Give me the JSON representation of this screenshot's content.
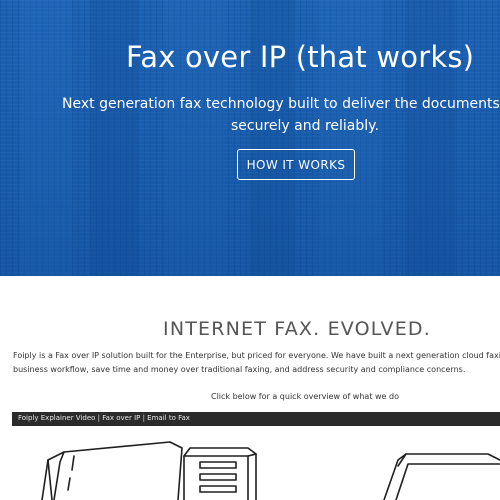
{
  "hero": {
    "title": "Fax over IP (that works)",
    "subtitle_line1": "Next generation fax technology built to deliver the documents that m",
    "subtitle_line2": "securely and reliably.",
    "button_label": "HOW IT WORKS",
    "background_color": "#1a5fb0"
  },
  "section": {
    "heading": "INTERNET FAX. EVOLVED.",
    "intro_line1": "Foiply is a Fax over IP solution built for the Enterprise, but priced for everyone. We have built a next generation cloud faxing platform",
    "intro_line2": "business workflow, save time and money over traditional faxing, and address security and compliance concerns.",
    "click_below": "Click below for a quick overview of what we do"
  },
  "video": {
    "title": "Foiply Explainer Video | Fax over IP | Email to Fax",
    "titlebar_color": "#2b2b2b"
  }
}
